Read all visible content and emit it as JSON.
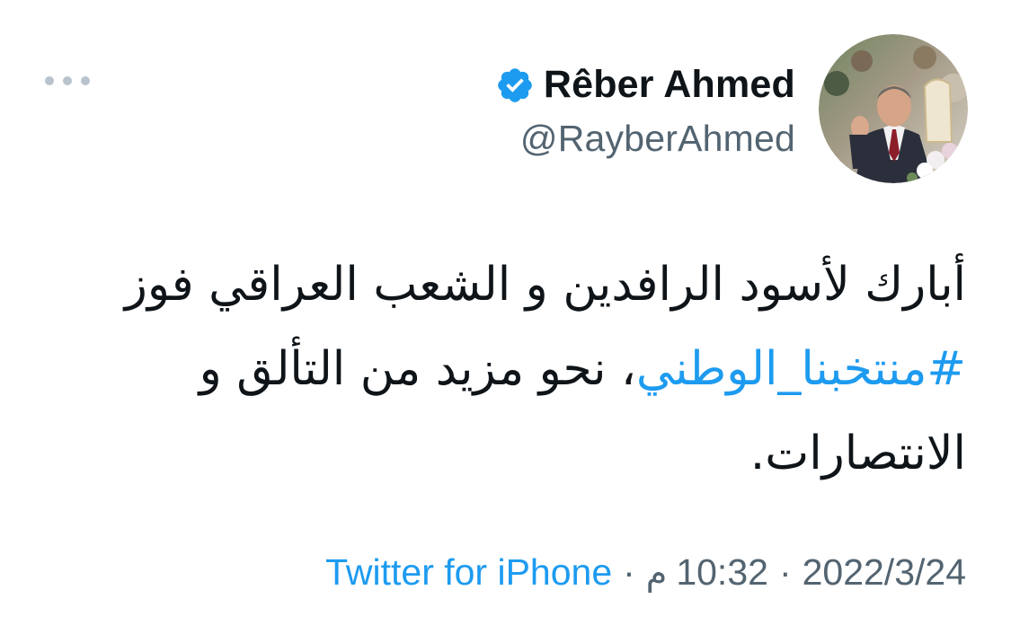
{
  "tweet": {
    "author": {
      "display_name": "Rêber Ahmed",
      "handle": "@RayberAhmed",
      "verified": true,
      "avatar_icon": "profile-photo"
    },
    "body": {
      "text_before": "أبارك لأسود الرافدين و الشعب العراقي فوز ",
      "hashtag": "#منتخبنا_الوطني",
      "text_after": "، نحو مزيد من التألق و الانتصارات."
    },
    "meta": {
      "date": "2022/3/24",
      "time": "10:32",
      "time_suffix": "م",
      "separator": "·",
      "source": "Twitter for iPhone"
    },
    "more_icon": "ellipsis-icon"
  },
  "colors": {
    "link": "#1d9bf0",
    "secondary_text": "#536471",
    "primary_text": "#0f1419",
    "more_dots": "#b9c3cd"
  }
}
